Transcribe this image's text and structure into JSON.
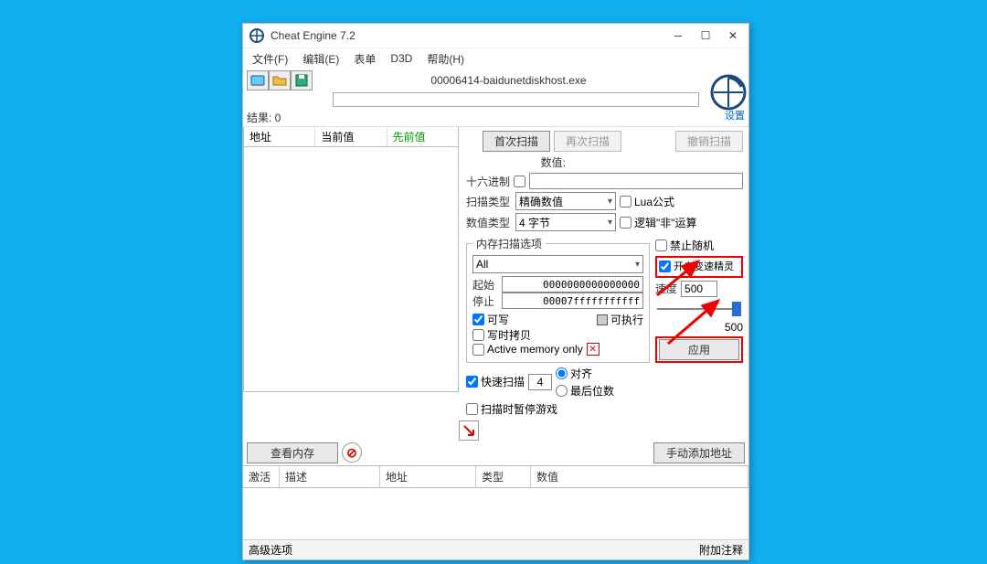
{
  "window": {
    "title": "Cheat Engine 7.2",
    "process": "00006414-baidunetdiskhost.exe",
    "settings_label": "设置"
  },
  "menu": {
    "file": "文件(F)",
    "edit": "编辑(E)",
    "table": "表单",
    "d3d": "D3D",
    "help": "帮助(H)"
  },
  "results": {
    "label": "结果: 0",
    "col_addr": "地址",
    "col_value": "当前值",
    "col_prev": "先前值"
  },
  "scan": {
    "first": "首次扫描",
    "next": "再次扫描",
    "undo": "撤销扫描",
    "value_label": "数值:",
    "hex_label": "十六进制",
    "scantype_label": "扫描类型",
    "scantype_value": "精确数值",
    "valuetype_label": "数值类型",
    "valuetype_value": "4 字节",
    "lua_formula": "Lua公式",
    "not_logic": "逻辑\"非\"运算"
  },
  "memopts": {
    "legend": "内存扫描选项",
    "range": "All",
    "start_label": "起始",
    "start_value": "0000000000000000",
    "stop_label": "停止",
    "stop_value": "00007fffffffffff",
    "writable": "可写",
    "executable": "可执行",
    "copyonwrite": "写时拷贝",
    "active_only": "Active memory only",
    "no_random": "禁止随机",
    "speedhack_enable": "开启变速精灵"
  },
  "speed": {
    "label": "速度",
    "value": "500",
    "max": "500",
    "apply": "应用"
  },
  "fastscan": {
    "label": "快速扫描",
    "value": "4",
    "align": "对齐",
    "lastdigit": "最后位数",
    "pause": "扫描时暂停游戏"
  },
  "mid": {
    "view_memory": "查看内存",
    "add_manual": "手动添加地址"
  },
  "table": {
    "active": "激活",
    "desc": "描述",
    "addr": "地址",
    "type": "类型",
    "value": "数值"
  },
  "footer": {
    "advanced": "高级选项",
    "annotate": "附加注释"
  }
}
